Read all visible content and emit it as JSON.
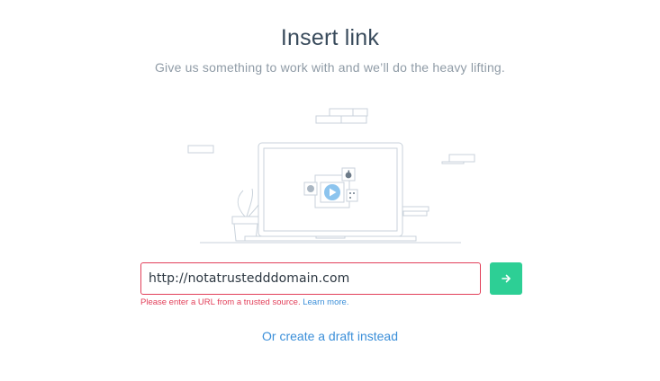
{
  "dialog": {
    "title": "Insert link",
    "subtitle": "Give us something to work with and we’ll do the heavy lifting."
  },
  "form": {
    "url_value": "http://notatrustedddomain.com",
    "submit_icon": "arrow-right-icon",
    "error_message": "Please enter a URL from a trusted source.",
    "learn_more_label": "Learn more."
  },
  "footer": {
    "draft_label": "Or create a draft instead"
  },
  "illustration": {
    "icons": [
      "laptop-icon",
      "play-icon",
      "apple-icon",
      "spotify-icon",
      "grid-icon",
      "plant-icon",
      "books-icon",
      "brick-wall-icon"
    ]
  },
  "colors": {
    "accent_green": "#2dcf95",
    "error_red": "#e2405a",
    "link_blue": "#3b8fd9",
    "title": "#394b5c",
    "muted": "#8f9ba6",
    "line_art": "#c9d2db",
    "play_blue": "#8cc4ee"
  }
}
